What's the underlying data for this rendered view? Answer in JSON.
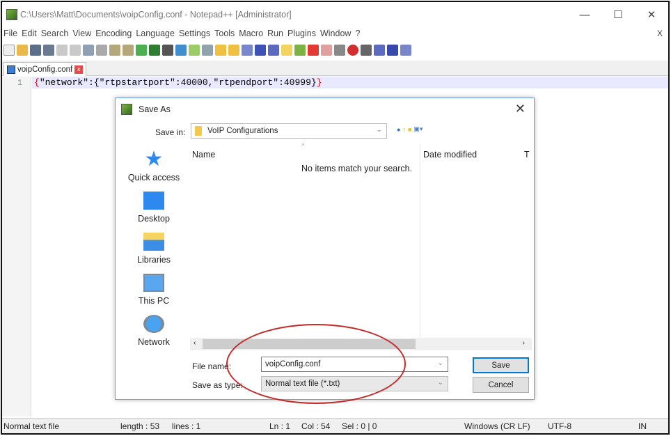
{
  "window": {
    "title": "C:\\Users\\Matt\\Documents\\voipConfig.conf - Notepad++ [Administrator]",
    "minimize": "—",
    "maximize": "☐",
    "close": "✕"
  },
  "menu": [
    "File",
    "Edit",
    "Search",
    "View",
    "Encoding",
    "Language",
    "Settings",
    "Tools",
    "Macro",
    "Run",
    "Plugins",
    "Window",
    "?"
  ],
  "menu_close": "X",
  "tab": {
    "label": "voipConfig.conf",
    "close": "x"
  },
  "editor": {
    "line_number": "1",
    "code_open": "{",
    "code_body": "\"network\":{\"rtpstartport\":40000,\"rtpendport\":40999}",
    "code_close": "}"
  },
  "status": {
    "type": "Normal text file",
    "length": "length : 53",
    "lines": "lines : 1",
    "ln": "Ln : 1",
    "col": "Col : 54",
    "sel": "Sel : 0 | 0",
    "eol": "Windows (CR LF)",
    "encoding": "UTF-8",
    "mode": "IN"
  },
  "dialog": {
    "title": "Save As",
    "close": "✕",
    "save_in_label": "Save in:",
    "save_in_value": "VoIP Configurations",
    "places": [
      {
        "label": "Quick access"
      },
      {
        "label": "Desktop"
      },
      {
        "label": "Libraries"
      },
      {
        "label": "This PC"
      },
      {
        "label": "Network"
      }
    ],
    "columns": {
      "name": "Name",
      "date": "Date modified",
      "type": "T"
    },
    "empty_message": "No items match your search.",
    "file_name_label": "File name:",
    "file_name_value": "voipConfig.conf",
    "save_type_label": "Save as type:",
    "save_type_value": "Normal text file (*.txt)",
    "save_button": "Save",
    "cancel_button": "Cancel"
  },
  "colors": {
    "annotation": "#c62828",
    "accent": "#0078d7"
  }
}
